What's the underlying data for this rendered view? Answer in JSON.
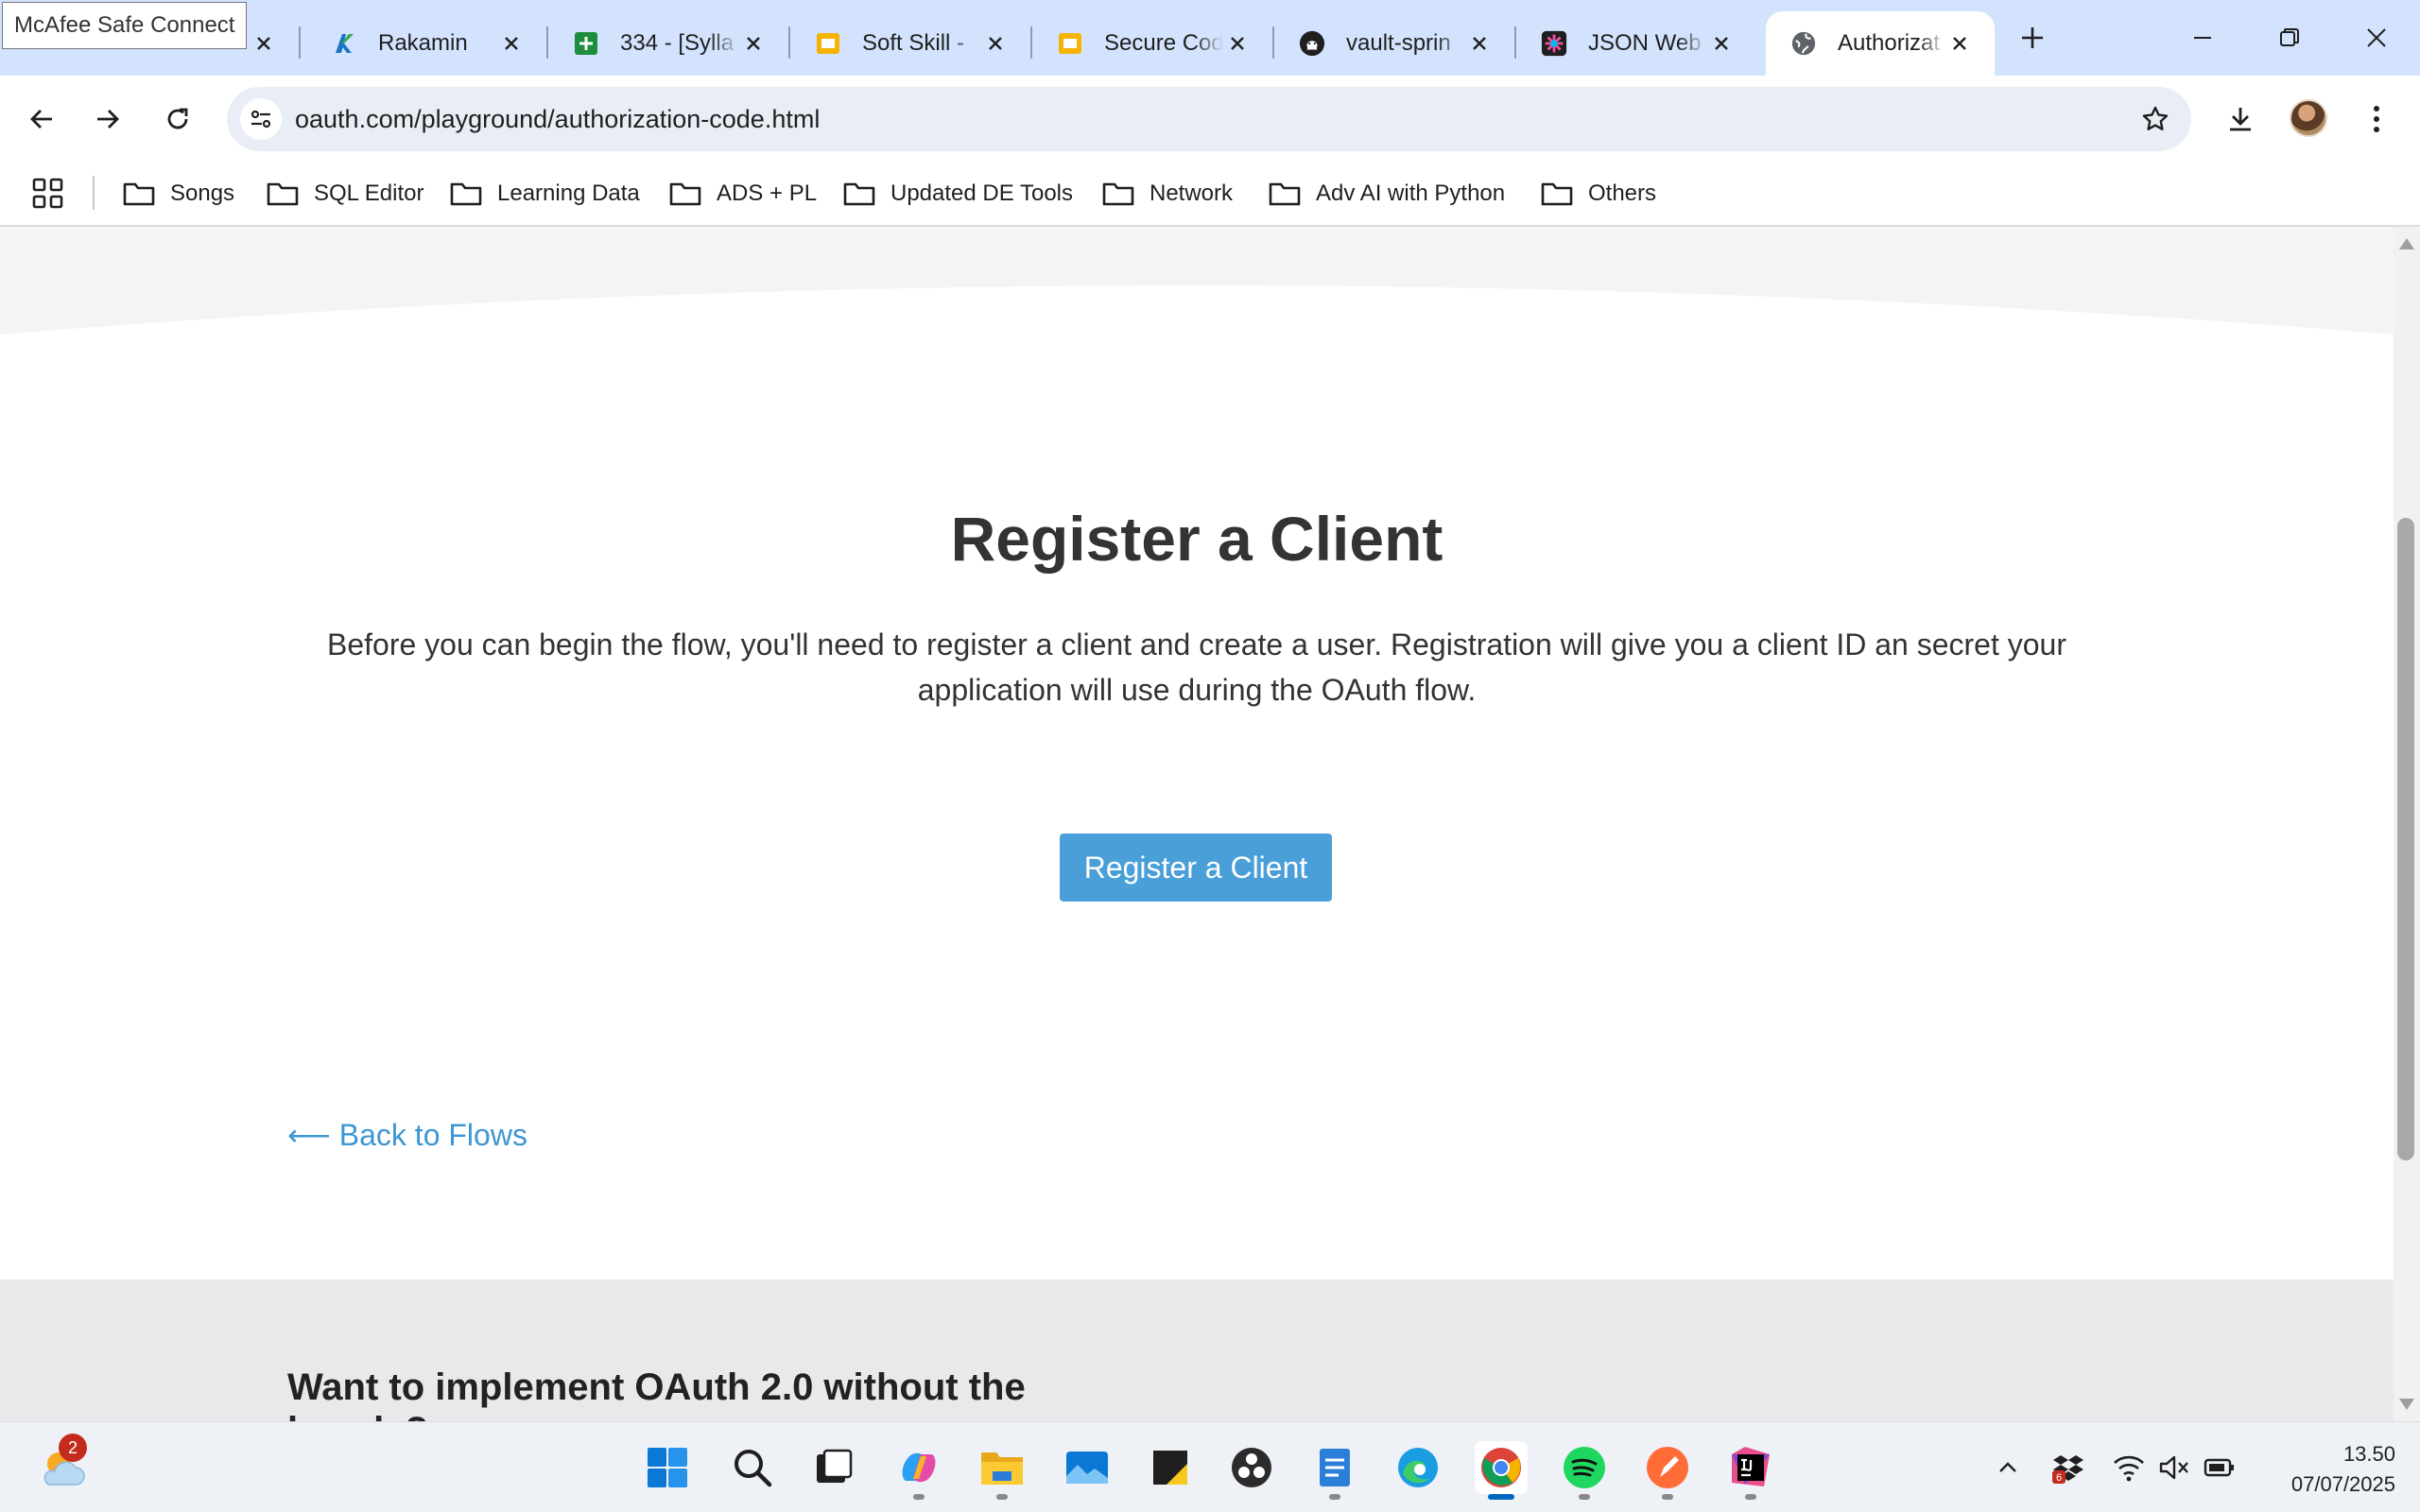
{
  "tooltip": "McAfee Safe Connect",
  "tabs": [
    {
      "title": "Rakamin",
      "favicon": "rakamin-icon"
    },
    {
      "title": "334 - [Sylla",
      "favicon": "sheets-icon"
    },
    {
      "title": "Soft Skill -",
      "favicon": "slides-icon"
    },
    {
      "title": "Secure Cod",
      "favicon": "slides-icon"
    },
    {
      "title": "vault-sprin",
      "favicon": "github-icon"
    },
    {
      "title": "JSON Web",
      "favicon": "jwt-icon"
    },
    {
      "title": "Authorizat",
      "favicon": "globe-icon"
    }
  ],
  "address_bar": {
    "url": "oauth.com/playground/authorization-code.html"
  },
  "bookmarks": [
    {
      "label": "Songs"
    },
    {
      "label": "SQL Editor"
    },
    {
      "label": "Learning Data"
    },
    {
      "label": "ADS + PL"
    },
    {
      "label": "Updated DE Tools"
    },
    {
      "label": "Network"
    },
    {
      "label": "Adv AI with Python"
    },
    {
      "label": "Others"
    }
  ],
  "page": {
    "heading": "Register a Client",
    "intro_line1": "Before you can begin the flow, you'll need to register a client and create a user. Registration will give you a client ID an secret your",
    "intro_line2": "application will use during the OAuth flow.",
    "register_button": "Register a Client",
    "back_link": "⟵ Back to Flows",
    "promo_heading_line1": "Want to implement OAuth 2.0 without the",
    "promo_heading_line2": "hassle?"
  },
  "taskbar": {
    "weather_badge": "2",
    "tray_badge": "6",
    "time": "13.50",
    "date": "07/07/2025"
  },
  "colors": {
    "tabstrip": "#d3e3fd",
    "primary_button": "#4a9fd8",
    "link": "#3d97d3"
  }
}
